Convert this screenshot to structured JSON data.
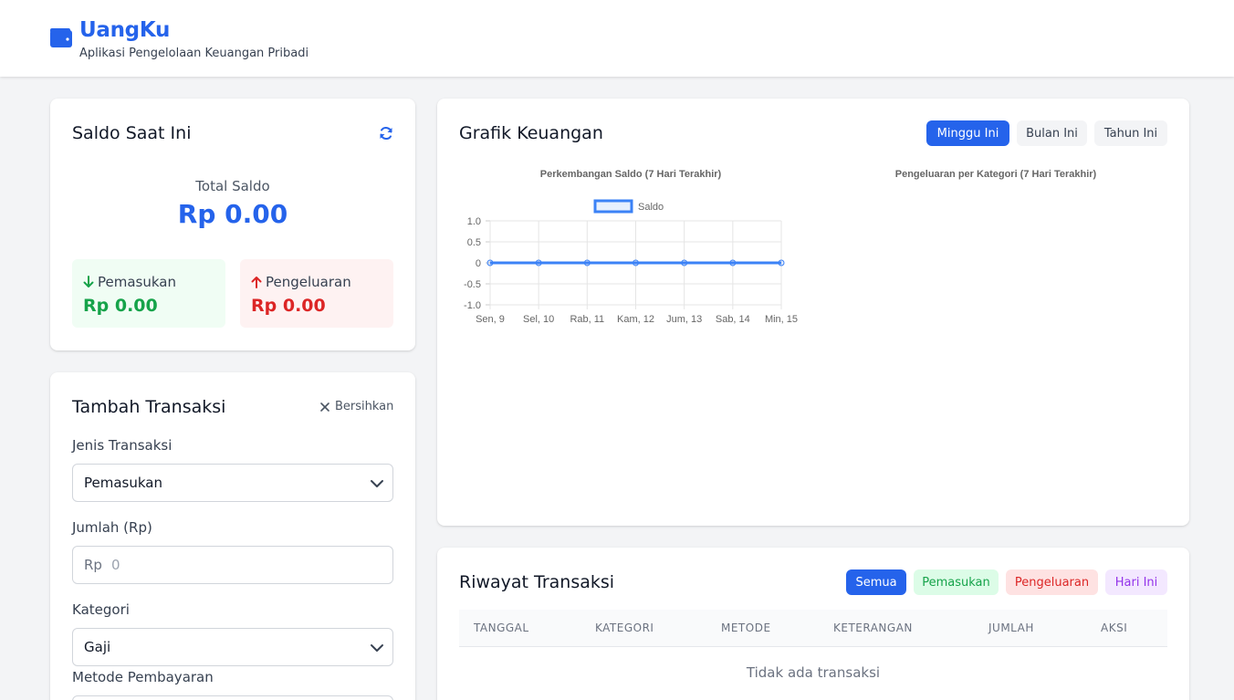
{
  "header": {
    "title": "UangKu",
    "subtitle": "Aplikasi Pengelolaan Keuangan Pribadi"
  },
  "saldo": {
    "title": "Saldo Saat Ini",
    "total_label": "Total Saldo",
    "total_value": "Rp 0.00",
    "income_label": "Pemasukan",
    "income_value": "Rp 0.00",
    "expense_label": "Pengeluaran",
    "expense_value": "Rp 0.00"
  },
  "form": {
    "title": "Tambah Transaksi",
    "clear_label": "Bersihkan",
    "type_label": "Jenis Transaksi",
    "type_value": "Pemasukan",
    "amount_label": "Jumlah (Rp)",
    "amount_prefix": "Rp",
    "amount_placeholder": "0",
    "category_label": "Kategori",
    "category_value": "Gaji",
    "method_label": "Metode Pembayaran"
  },
  "chart_panel": {
    "title": "Grafik Keuangan",
    "tabs": [
      "Minggu Ini",
      "Bulan Ini",
      "Tahun Ini"
    ],
    "active_tab": "Minggu Ini",
    "pie_title": "Pengeluaran per Kategori (7 Hari Terakhir)"
  },
  "chart_data": {
    "type": "line",
    "title": "Perkembangan Saldo (7 Hari Terakhir)",
    "categories": [
      "Sen, 9",
      "Sel, 10",
      "Rab, 11",
      "Kam, 12",
      "Jum, 13",
      "Sab, 14",
      "Min, 15"
    ],
    "series": [
      {
        "name": "Saldo",
        "values": [
          0,
          0,
          0,
          0,
          0,
          0,
          0
        ]
      }
    ],
    "ylim": [
      -1.0,
      1.0
    ],
    "yticks": [
      "1.0",
      "0.5",
      "0",
      "-0.5",
      "-1.0"
    ],
    "grid": true,
    "legend": "top",
    "color": "#3b82f6"
  },
  "history": {
    "title": "Riwayat Transaksi",
    "filters": [
      "Semua",
      "Pemasukan",
      "Pengeluaran",
      "Hari Ini"
    ],
    "active_filter": "Semua",
    "columns": [
      "TANGGAL",
      "KATEGORI",
      "METODE",
      "KETERANGAN",
      "JUMLAH",
      "AKSI"
    ],
    "empty_message": "Tidak ada transaksi"
  },
  "colors": {
    "primary": "#2563eb",
    "income": "#16a34a",
    "expense": "#dc2626",
    "today": "#9333ea"
  }
}
